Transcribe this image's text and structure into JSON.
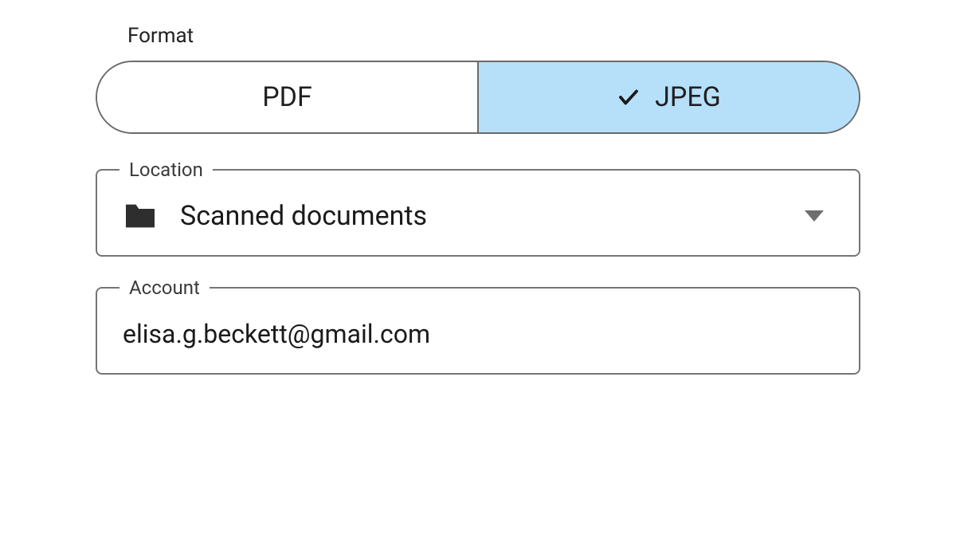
{
  "format": {
    "label": "Format",
    "options": {
      "pdf": "PDF",
      "jpeg": "JPEG"
    },
    "selected": "jpeg"
  },
  "location": {
    "label": "Location",
    "value": "Scanned documents"
  },
  "account": {
    "label": "Account",
    "value": "elisa.g.beckett@gmail.com"
  }
}
